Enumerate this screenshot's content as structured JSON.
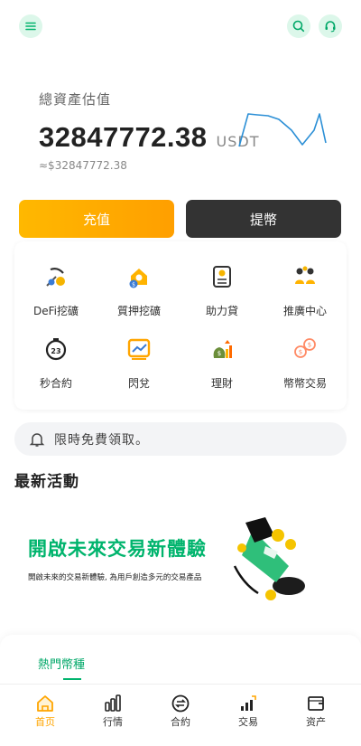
{
  "header": {
    "menu_icon": "menu-icon",
    "search_icon": "search-icon",
    "support_icon": "headset-icon"
  },
  "asset": {
    "label": "總資產估值",
    "value": "32847772.38",
    "unit": "USDT",
    "usd_value": "≈$32847772.38",
    "trend_color": "#2b8fd6"
  },
  "actions": {
    "deposit": "充值",
    "withdraw": "提幣"
  },
  "grid": [
    {
      "label": "DeFi挖礦",
      "icon": "mining-icon"
    },
    {
      "label": "質押挖礦",
      "icon": "staking-icon"
    },
    {
      "label": "助力貸",
      "icon": "loan-icon"
    },
    {
      "label": "推廣中心",
      "icon": "referral-icon"
    },
    {
      "label": "秒合約",
      "icon": "stopwatch-icon"
    },
    {
      "label": "閃兌",
      "icon": "exchange-chart-icon"
    },
    {
      "label": "理財",
      "icon": "finance-icon"
    },
    {
      "label": "幣幣交易",
      "icon": "coin-swap-icon"
    }
  ],
  "notice": {
    "text": "限時免費領取。",
    "icon": "bell-icon"
  },
  "section": {
    "title": "最新活動"
  },
  "banner": {
    "title": "開啟未來交易新體驗",
    "subtitle": "開啟未來的交易新體驗, 為用戶創造多元的交易產品"
  },
  "hot": {
    "tab": "熱門幣種"
  },
  "tabbar": [
    {
      "label": "首页",
      "icon": "home-icon",
      "active": true
    },
    {
      "label": "行情",
      "icon": "market-icon",
      "active": false
    },
    {
      "label": "合約",
      "icon": "contract-icon",
      "active": false
    },
    {
      "label": "交易",
      "icon": "trade-icon",
      "active": false
    },
    {
      "label": "资产",
      "icon": "wallet-icon",
      "active": false
    }
  ],
  "colors": {
    "brand_green": "#00b46d",
    "accent_orange": "#ffa500",
    "dark_button": "#333333"
  }
}
